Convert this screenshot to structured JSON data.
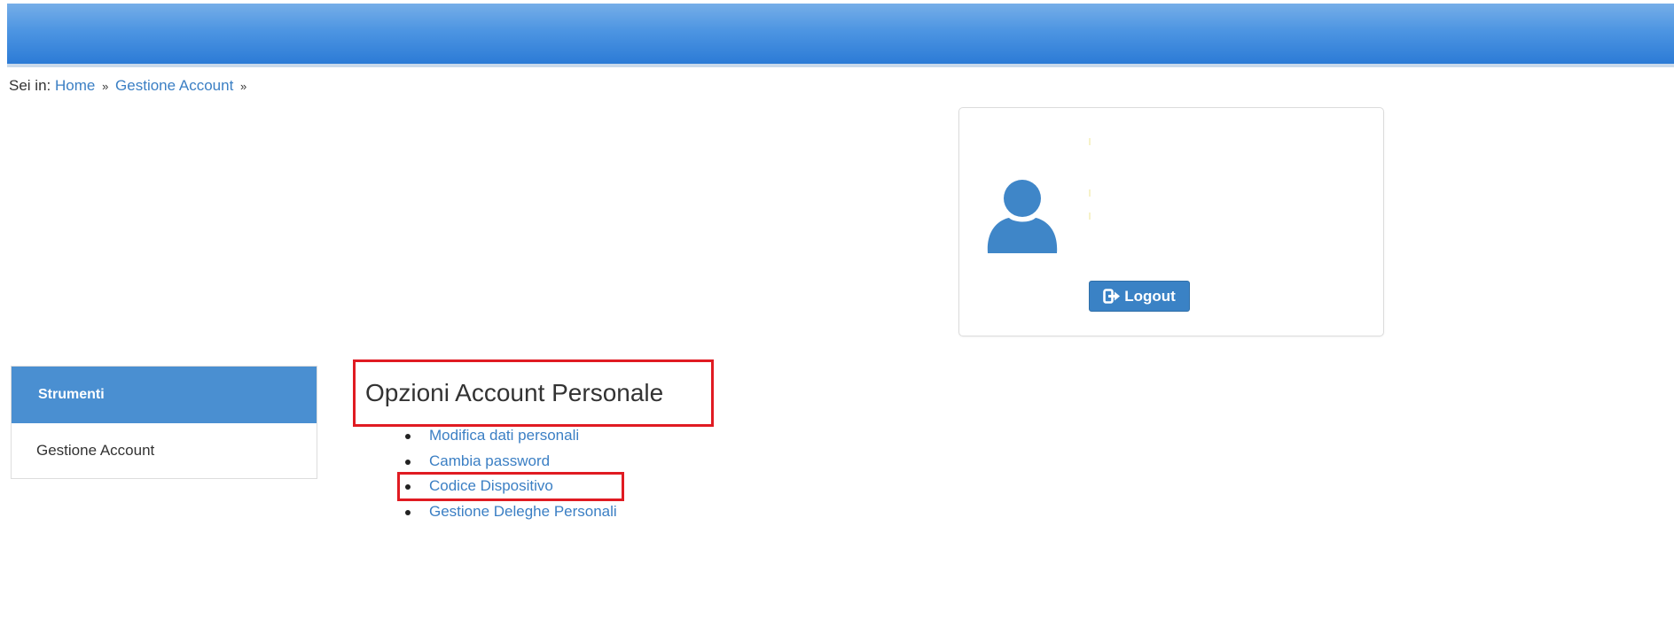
{
  "breadcrumb": {
    "prefix": "Sei in:",
    "items": [
      "Home",
      "Gestione Account"
    ],
    "separator": "»"
  },
  "user_card": {
    "avatar_icon": "user-icon",
    "logout_icon": "sign-out-icon",
    "logout_label": "Logout"
  },
  "sidebar": {
    "title": "Strumenti",
    "items": [
      {
        "label": "Gestione Account"
      }
    ]
  },
  "main": {
    "title": "Opzioni Account Personale",
    "options": [
      {
        "label": "Modifica dati personali"
      },
      {
        "label": "Cambia password"
      },
      {
        "label": "Codice Dispositivo"
      },
      {
        "label": "Gestione Deleghe Personali"
      }
    ]
  },
  "colors": {
    "banner": "#2c7bd6",
    "link": "#3b7fc4",
    "sidebar_header": "#4a8fd1",
    "button": "#3a82c5",
    "highlight": "#e01b22"
  }
}
